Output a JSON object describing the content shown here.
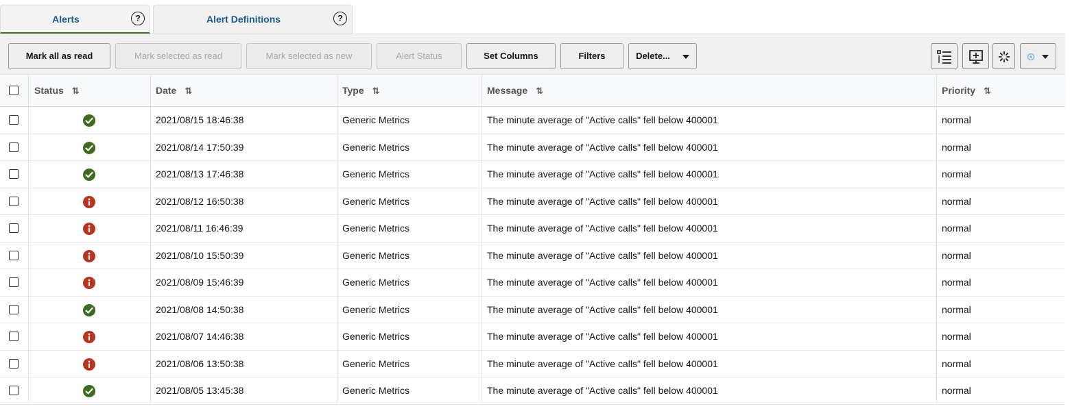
{
  "tabs": [
    {
      "label": "Alerts",
      "help": "?",
      "active": true
    },
    {
      "label": "Alert Definitions",
      "help": "?",
      "active": false
    }
  ],
  "toolbar": {
    "mark_all_read": "Mark all as read",
    "mark_selected_read": "Mark selected as read",
    "mark_selected_new": "Mark selected as new",
    "alert_status": "Alert Status",
    "set_columns": "Set Columns",
    "filters": "Filters",
    "delete": "Delete...",
    "icons": [
      "list-view-icon",
      "add-display-icon",
      "loading-spinner-icon",
      "settings-dropdown-icon"
    ]
  },
  "table": {
    "columns": [
      "Status",
      "Date",
      "Type",
      "Message",
      "Priority"
    ],
    "sort_glyph": "⇅",
    "rows": [
      {
        "status": "ok",
        "date": "2021/08/15 18:46:38",
        "type": "Generic Metrics",
        "message": "The minute average of \"Active calls\" fell below 400001",
        "priority": "normal"
      },
      {
        "status": "ok",
        "date": "2021/08/14 17:50:39",
        "type": "Generic Metrics",
        "message": "The minute average of \"Active calls\" fell below 400001",
        "priority": "normal"
      },
      {
        "status": "ok",
        "date": "2021/08/13 17:46:38",
        "type": "Generic Metrics",
        "message": "The minute average of \"Active calls\" fell below 400001",
        "priority": "normal"
      },
      {
        "status": "err",
        "date": "2021/08/12 16:50:38",
        "type": "Generic Metrics",
        "message": "The minute average of \"Active calls\" fell below 400001",
        "priority": "normal"
      },
      {
        "status": "err",
        "date": "2021/08/11 16:46:39",
        "type": "Generic Metrics",
        "message": "The minute average of \"Active calls\" fell below 400001",
        "priority": "normal"
      },
      {
        "status": "err",
        "date": "2021/08/10 15:50:39",
        "type": "Generic Metrics",
        "message": "The minute average of \"Active calls\" fell below 400001",
        "priority": "normal"
      },
      {
        "status": "err",
        "date": "2021/08/09 15:46:39",
        "type": "Generic Metrics",
        "message": "The minute average of \"Active calls\" fell below 400001",
        "priority": "normal"
      },
      {
        "status": "ok",
        "date": "2021/08/08 14:50:38",
        "type": "Generic Metrics",
        "message": "The minute average of \"Active calls\" fell below 400001",
        "priority": "normal"
      },
      {
        "status": "err",
        "date": "2021/08/07 14:46:38",
        "type": "Generic Metrics",
        "message": "The minute average of \"Active calls\" fell below 400001",
        "priority": "normal"
      },
      {
        "status": "err",
        "date": "2021/08/06 13:50:38",
        "type": "Generic Metrics",
        "message": "The minute average of \"Active calls\" fell below 400001",
        "priority": "normal"
      },
      {
        "status": "ok",
        "date": "2021/08/05 13:45:38",
        "type": "Generic Metrics",
        "message": "The minute average of \"Active calls\" fell below 400001",
        "priority": "normal"
      }
    ]
  },
  "colors": {
    "ok": "#3e6b20",
    "err": "#b83421",
    "tab_text": "#1b5a8a"
  }
}
